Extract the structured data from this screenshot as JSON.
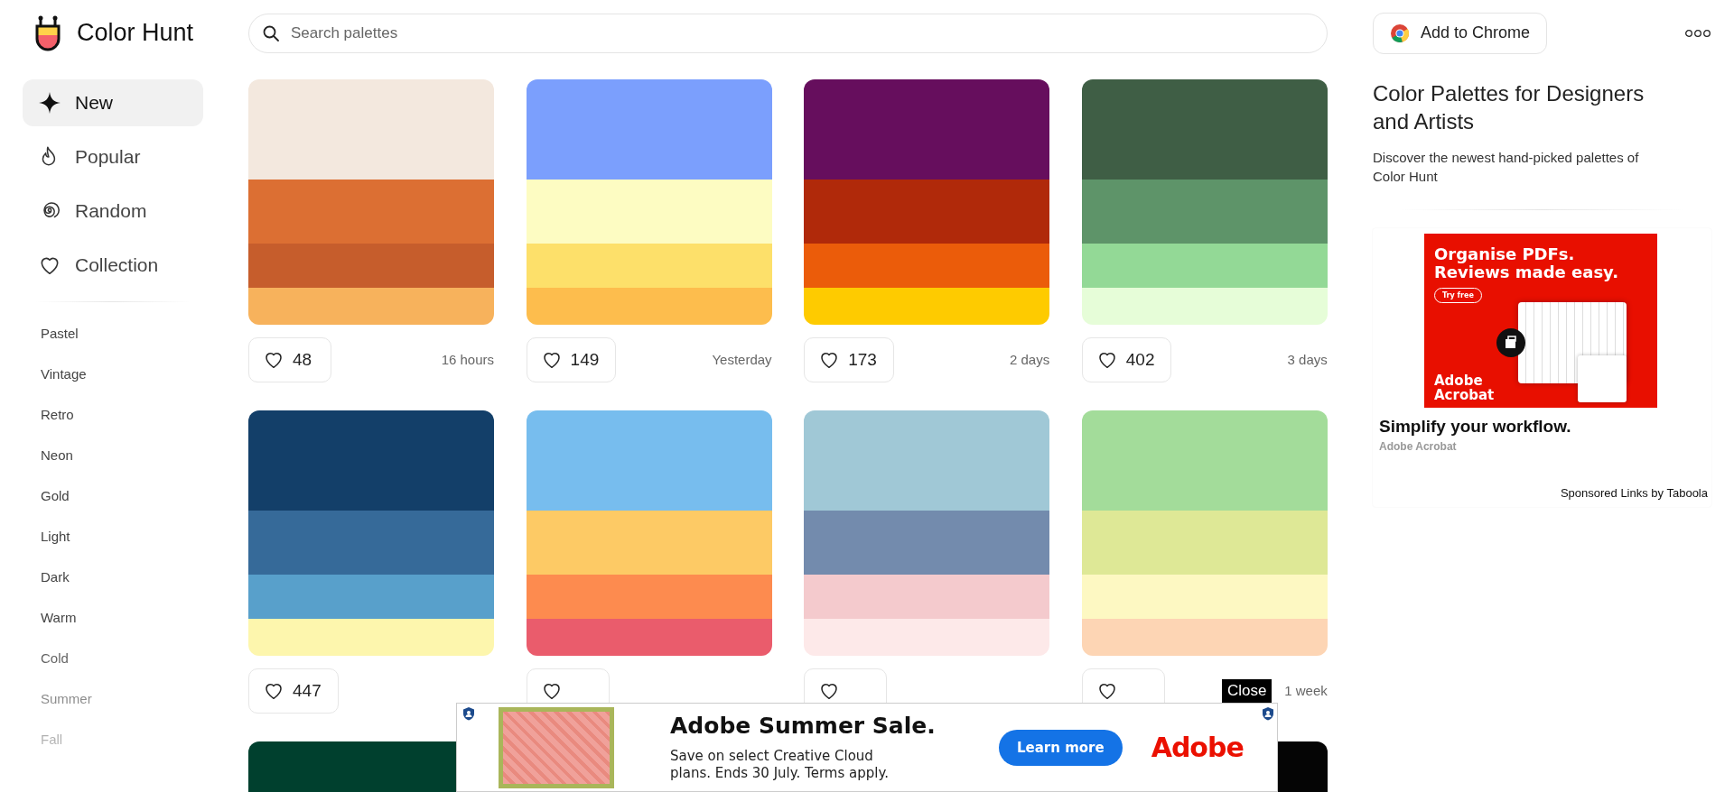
{
  "header": {
    "logo": "Color Hunt",
    "search": {
      "placeholder": "Search palettes"
    },
    "chrome_button": "Add to Chrome"
  },
  "sidebar": {
    "nav": [
      {
        "label": "New",
        "kind": "sparkle",
        "selected": true
      },
      {
        "label": "Popular",
        "kind": "flame",
        "selected": false
      },
      {
        "label": "Random",
        "kind": "spiral",
        "selected": false
      },
      {
        "label": "Collection",
        "kind": "heart",
        "selected": false
      }
    ],
    "categories": [
      "Pastel",
      "Vintage",
      "Retro",
      "Neon",
      "Gold",
      "Light",
      "Dark",
      "Warm",
      "Cold",
      "Summer",
      "Fall"
    ]
  },
  "palettes": [
    {
      "swatches": [
        {
          "color": "#f3e8de"
        },
        {
          "color": "#dc6f33"
        },
        {
          "color": "#c65d2c"
        },
        {
          "color": "#f7b25c"
        }
      ],
      "likes": "48",
      "time": "16 hours"
    },
    {
      "swatches": [
        {
          "color": "#7b9ffd"
        },
        {
          "color": "#fdfcc2"
        },
        {
          "color": "#fde06a"
        },
        {
          "color": "#fdbd4d"
        }
      ],
      "likes": "149",
      "time": "Yesterday"
    },
    {
      "swatches": [
        {
          "color": "#660e5d"
        },
        {
          "color": "#b0290a"
        },
        {
          "color": "#eb5c0a"
        },
        {
          "color": "#fecb00"
        }
      ],
      "likes": "173",
      "time": "2 days"
    },
    {
      "swatches": [
        {
          "color": "#3f5e45"
        },
        {
          "color": "#5e9469"
        },
        {
          "color": "#93d996"
        },
        {
          "color": "#e6fdd8"
        }
      ],
      "likes": "402",
      "time": "3 days"
    },
    {
      "swatches": [
        {
          "color": "#133f69"
        },
        {
          "color": "#366a99"
        },
        {
          "color": "#58a0cb"
        },
        {
          "color": "#fdf6ad"
        }
      ],
      "likes": "447"
    },
    {
      "swatches": [
        {
          "color": "#77bdee"
        },
        {
          "color": "#fdca65"
        },
        {
          "color": "#fd8b4f"
        },
        {
          "color": "#ea5c6c"
        }
      ]
    },
    {
      "swatches": [
        {
          "color": "#a0c8d6"
        },
        {
          "color": "#738bad"
        },
        {
          "color": "#f4cacd"
        },
        {
          "color": "#fde9e9"
        }
      ]
    },
    {
      "swatches": [
        {
          "color": "#a3dc9a"
        },
        {
          "color": "#dee896"
        },
        {
          "color": "#fdf8c2"
        },
        {
          "color": "#fdd5b4"
        }
      ],
      "time": "1 week"
    },
    {
      "swatches": [
        {
          "color": "#00402e"
        }
      ]
    },
    {
      "swatches": [
        {
          "color": "#050505"
        }
      ]
    }
  ],
  "info": {
    "title": "Color Palettes for Designers and Artists",
    "text": "Discover the newest hand-picked palettes of Color Hunt"
  },
  "sponsored": {
    "image_headline": "Organise PDFs. Reviews made easy.",
    "image_button": "Try free",
    "image_brand": "Adobe Acrobat",
    "headline": "Simplify your workflow.",
    "source": "Adobe Acrobat",
    "credit": "Sponsored Links by Taboola"
  },
  "banner_ad": {
    "headline": "Adobe Summer Sale.",
    "text": "Save on select Creative Cloud plans. Ends 30 July. Terms apply.",
    "button": "Learn more",
    "brand": "Adobe",
    "close": "Close"
  }
}
